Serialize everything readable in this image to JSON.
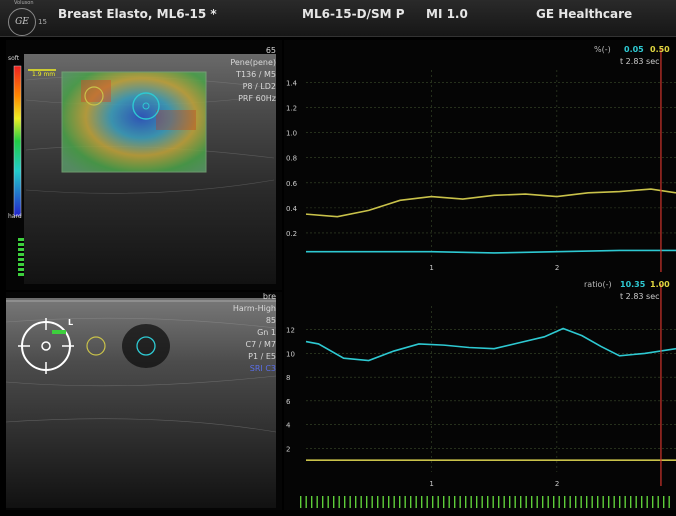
{
  "header": {
    "brand": "Voluson",
    "brand_num": "15",
    "logo": "GE",
    "preset": "Breast Elasto, ML6-15  *",
    "probe": "ML6-15-D/SM P",
    "mi": "MI  1.0",
    "company": "GE Healthcare"
  },
  "upper_image": {
    "depth": "65",
    "params": [
      "Pene(pene)",
      "T136 / M5",
      "P8 / LD2",
      "PRF 60Hz"
    ],
    "scale_top": "soft",
    "scale_bottom": "hard",
    "scale_value": "1.9 mm"
  },
  "lower_image": {
    "depth": "bre",
    "params": [
      "Harm-High",
      "85",
      "Gn   1",
      "C7 / M7",
      "P1 / E5",
      "SRI C3"
    ],
    "orientation": "L"
  },
  "strain_chart": {
    "legend_label": "%(-)",
    "value_cyan": "0.05",
    "value_yellow": "0.50",
    "time": "t 2.83 sec"
  },
  "ratio_chart": {
    "legend_label": "ratio(-)",
    "value_cyan": "10.35",
    "value_yellow": "1.00",
    "time": "t 2.83 sec"
  },
  "colors": {
    "cyan": "#2ec9d2",
    "yellow": "#c9c24a",
    "marker": "#d0342c",
    "grid": "#3b4a2b"
  },
  "chart_data": [
    {
      "type": "line",
      "ylim": [
        0,
        1.5
      ],
      "y_ticks": [
        "0.2",
        "0.4",
        "0.6",
        "0.8",
        "1.0",
        "1.2",
        "1.4"
      ],
      "x_ticks": [
        "1",
        "2"
      ],
      "series": [
        {
          "color": "#c9c24a",
          "x": [
            0,
            0.25,
            0.5,
            0.75,
            1.0,
            1.25,
            1.5,
            1.75,
            2.0,
            2.25,
            2.5,
            2.75,
            2.95
          ],
          "values": [
            0.35,
            0.33,
            0.38,
            0.46,
            0.49,
            0.47,
            0.5,
            0.51,
            0.49,
            0.52,
            0.53,
            0.55,
            0.52
          ]
        },
        {
          "color": "#2ec9d2",
          "x": [
            0,
            0.5,
            1.0,
            1.5,
            2.0,
            2.5,
            2.95
          ],
          "values": [
            0.05,
            0.05,
            0.05,
            0.04,
            0.05,
            0.06,
            0.06
          ]
        }
      ],
      "marker_x": 2.83
    },
    {
      "type": "line",
      "ylim": [
        0,
        14
      ],
      "y_ticks": [
        "2",
        "4",
        "6",
        "8",
        "10",
        "12"
      ],
      "x_ticks": [
        "1",
        "2"
      ],
      "series": [
        {
          "color": "#2ec9d2",
          "x": [
            0,
            0.1,
            0.3,
            0.5,
            0.7,
            0.9,
            1.1,
            1.3,
            1.5,
            1.7,
            1.9,
            2.05,
            2.2,
            2.35,
            2.5,
            2.7,
            2.95
          ],
          "values": [
            11,
            10.8,
            9.6,
            9.4,
            10.2,
            10.8,
            10.7,
            10.5,
            10.4,
            10.9,
            11.4,
            12.1,
            11.5,
            10.6,
            9.8,
            10.0,
            10.4
          ]
        },
        {
          "color": "#c9c24a",
          "x": [
            0,
            2.95
          ],
          "values": [
            1.0,
            1.0
          ]
        }
      ],
      "marker_x": 2.83
    }
  ]
}
